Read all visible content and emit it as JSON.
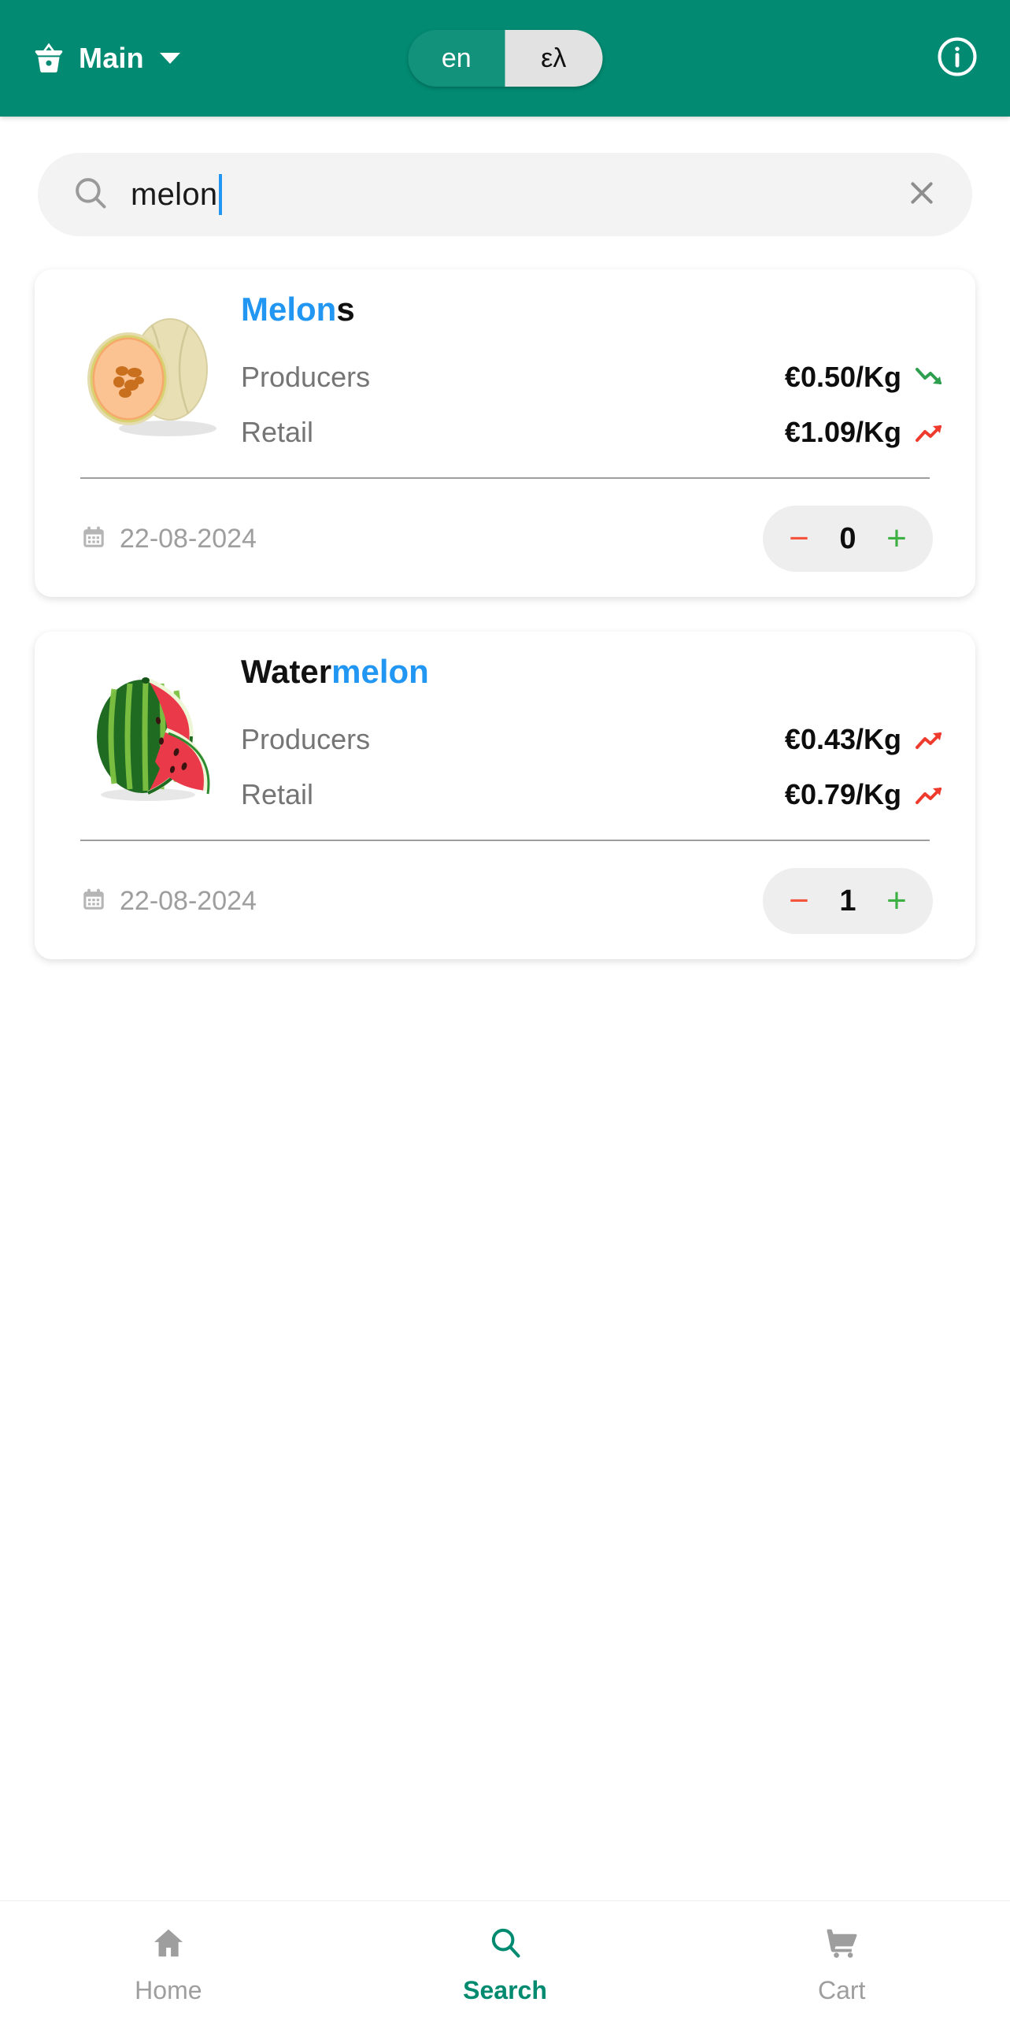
{
  "header": {
    "brand_label": "Main",
    "brand_icon": "shopping-basket-icon",
    "dropdown_icon": "chevron-down-icon",
    "info_icon": "info-circle-icon",
    "language": {
      "options": [
        {
          "code": "en",
          "label": "en",
          "active": false
        },
        {
          "code": "el",
          "label": "ελ",
          "active": true
        }
      ]
    },
    "bg_color": "#028a72"
  },
  "search": {
    "value": "melon",
    "placeholder": "Search",
    "search_icon": "search-icon",
    "clear_icon": "close-x-icon",
    "cursor_color": "#2196f3"
  },
  "results": [
    {
      "image": "cantaloupe-melon-image",
      "title_match": "Melon",
      "title_rest": "s",
      "match_first": true,
      "prices": [
        {
          "label": "Producers",
          "value": "€0.50/Kg",
          "trend": "down",
          "trend_color": "#2e9e4f"
        },
        {
          "label": "Retail",
          "value": "€1.09/Kg",
          "trend": "up",
          "trend_color": "#ef3b2d"
        }
      ],
      "date": "22-08-2024",
      "date_icon": "calendar-icon",
      "quantity": "0",
      "minus_label": "−",
      "plus_label": "+"
    },
    {
      "image": "watermelon-image",
      "title_match": "melon",
      "title_rest": "Water",
      "match_first": false,
      "prices": [
        {
          "label": "Producers",
          "value": "€0.43/Kg",
          "trend": "up",
          "trend_color": "#ef3b2d"
        },
        {
          "label": "Retail",
          "value": "€0.79/Kg",
          "trend": "up",
          "trend_color": "#ef3b2d"
        }
      ],
      "date": "22-08-2024",
      "date_icon": "calendar-icon",
      "quantity": "1",
      "minus_label": "−",
      "plus_label": "+"
    }
  ],
  "bottom_nav": {
    "items": [
      {
        "label": "Home",
        "icon": "home-icon",
        "active": false
      },
      {
        "label": "Search",
        "icon": "search-icon",
        "active": true
      },
      {
        "label": "Cart",
        "icon": "shopping-cart-icon",
        "active": false
      }
    ],
    "active_color": "#008a70",
    "inactive_color": "#9e9e9e"
  }
}
